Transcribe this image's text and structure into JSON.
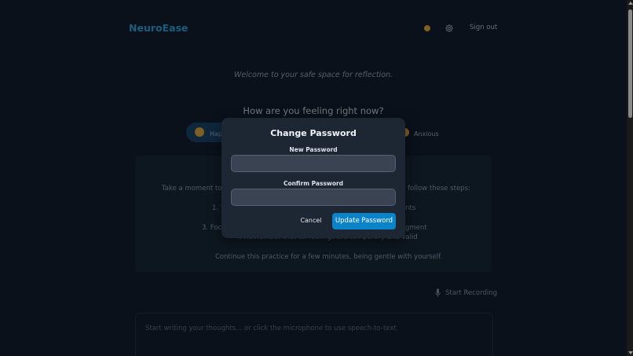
{
  "header": {
    "brand": "NeuroEase",
    "signout_label": "Sign out"
  },
  "main": {
    "welcome": "Welcome to your safe space for reflection.",
    "feeling_question": "How are you feeling right now?",
    "moods": [
      {
        "label": "Happ",
        "selected": true
      },
      {
        "label": "Anxious",
        "selected": false
      }
    ],
    "exercise": {
      "line1_left": "Take a moment to ac",
      "line1_right": "d follow these steps:",
      "line2_left": "1. T",
      "line2_right": "nts",
      "line3_left": "3. Focu",
      "line3_right": "gment",
      "line4": "4. Remember that all feelings are temporary and valid",
      "closing": "Continue this practice for a few minutes, being gentle with yourself."
    },
    "start_recording": "Start Recording",
    "journal_placeholder": "Start writing your thoughts... or click the microphone to use speech-to-text"
  },
  "modal": {
    "title": "Change Password",
    "new_password_label": "New Password",
    "confirm_password_label": "Confirm Password",
    "new_password_value": "",
    "confirm_password_value": "",
    "cancel_label": "Cancel",
    "update_label": "Update Password"
  },
  "colors": {
    "brand": "#2f9fd8",
    "primary_button": "#0b83c8",
    "background": "#0f1723",
    "modal_background": "#1d2633"
  }
}
